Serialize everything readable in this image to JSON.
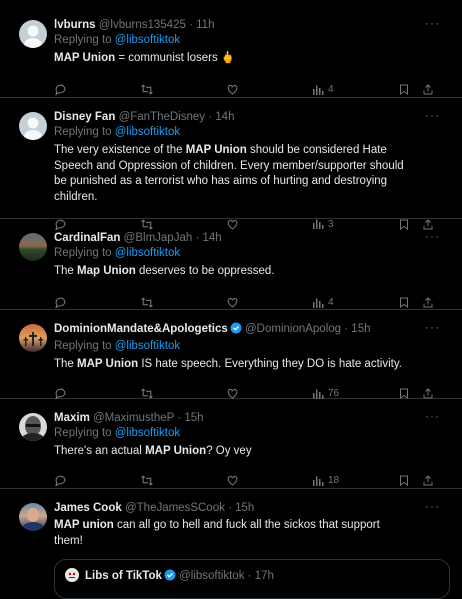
{
  "colors": {
    "background": "#000000",
    "text": "#e7e9ea",
    "muted": "#71767b",
    "link": "#1d9bf0",
    "border": "#2f3336"
  },
  "replying_prefix": "Replying to ",
  "tweets": [
    {
      "name": "lvburns",
      "handle": "@lvburns135425",
      "time": "11h",
      "reply_to": "@libsoftiktok",
      "body_bold": "MAP Union",
      "body_rest": " = communist losers 🖕",
      "views": "4",
      "avatar": "default"
    },
    {
      "name": "Disney Fan",
      "handle": "@FanTheDisney",
      "time": "14h",
      "reply_to": "@libsoftiktok",
      "body_pre": "The very existence of the ",
      "body_bold": "MAP Union",
      "body_rest": " should be considered Hate Speech and Oppression of children. Every member/supporter should be punished as a terrorist who has aims of hurting and destroying children.",
      "views": "3",
      "avatar": "default"
    },
    {
      "name": "CardinalFan",
      "handle": "@BlmJapJah",
      "time": "14h",
      "reply_to": "@libsoftiktok",
      "body_pre": "The ",
      "body_bold": "Map Union",
      "body_rest": " deserves to be oppressed.",
      "views": "4",
      "avatar": "stadium"
    },
    {
      "name": "DominionMandate&Apologetics",
      "handle": "@DominionApolog",
      "time": "15h",
      "reply_to": "@libsoftiktok",
      "body_pre": "The ",
      "body_bold": "MAP Union",
      "body_rest": " IS hate speech. Everything they DO is hate activity.",
      "views": "76",
      "avatar": "crosses",
      "verified": true
    },
    {
      "name": "Maxim",
      "handle": "@MaximustheP",
      "time": "15h",
      "reply_to": "@libsoftiktok",
      "body_pre": "There's an actual ",
      "body_bold": "MAP Union",
      "body_rest": "? Oy vey",
      "views": "18",
      "avatar": "face"
    },
    {
      "name": "James Cook",
      "handle": "@TheJamesSCook",
      "time": "15h",
      "body_bold": "MAP union",
      "body_rest": " can all go to hell and fuck all the sickos that support them!",
      "avatar": "photo",
      "quote": {
        "name": "Libs of TikTok",
        "handle": "@libsoftiktok",
        "time": "17h"
      }
    }
  ]
}
